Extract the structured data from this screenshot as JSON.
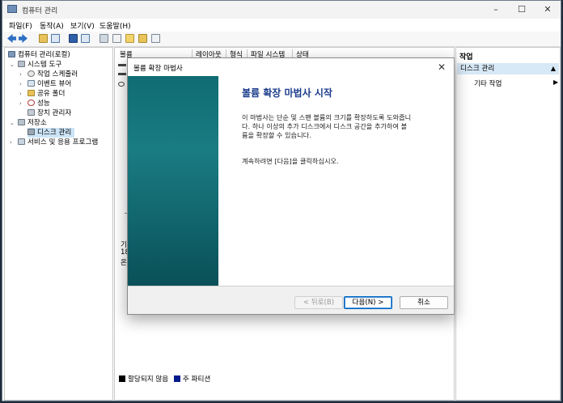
{
  "window": {
    "title": "컴퓨터 관리",
    "controls": [
      "–",
      "☐",
      "✕"
    ]
  },
  "menu": [
    "파일(F)",
    "동작(A)",
    "보기(V)",
    "도움말(H)"
  ],
  "tree": {
    "root": "컴퓨터 관리(로컬)",
    "system_tools": "시스템 도구",
    "task_scheduler": "작업 스케줄러",
    "event_viewer": "이벤트 뷰어",
    "shared_folders": "공유 폴더",
    "performance": "성능",
    "device_manager": "장치 관리자",
    "storage": "저장소",
    "disk_management": "디스크 관리",
    "services_apps": "서비스 및 응용 프로그램"
  },
  "volume_table": {
    "columns": [
      "볼륨",
      "레이아웃",
      "형식",
      "파일 시스템",
      "상태"
    ]
  },
  "disk_panel": {
    "line1": "기",
    "line2": "18",
    "line3": "온"
  },
  "legend": {
    "unallocated": "할당되지 않음",
    "primary": "주 파티션"
  },
  "actions": {
    "header": "작업",
    "section": "디스크 관리",
    "more": "기타 작업"
  },
  "dialog": {
    "title": "볼륨 확장 마법사",
    "heading": "볼륨 확장 마법사 시작",
    "para1_l1": "이 마법사는 단순 및 스팬 볼륨의 크기를 확장하도록 도와줍니",
    "para1_l2": "다. 하나 이상의 추가 디스크에서 디스크 공간을 추가하여 볼",
    "para1_l3": "륨을 확장할 수 있습니다.",
    "para2": "계속하려면 [다음]을 클릭하십시오.",
    "back_label": "< 뒤로(B)",
    "next_label": "다음(N) >",
    "cancel_label": "취소"
  },
  "colors": {
    "wizard_banner": "#0f6c72",
    "heading": "#1c3d8c",
    "selection": "#cce4f7"
  }
}
